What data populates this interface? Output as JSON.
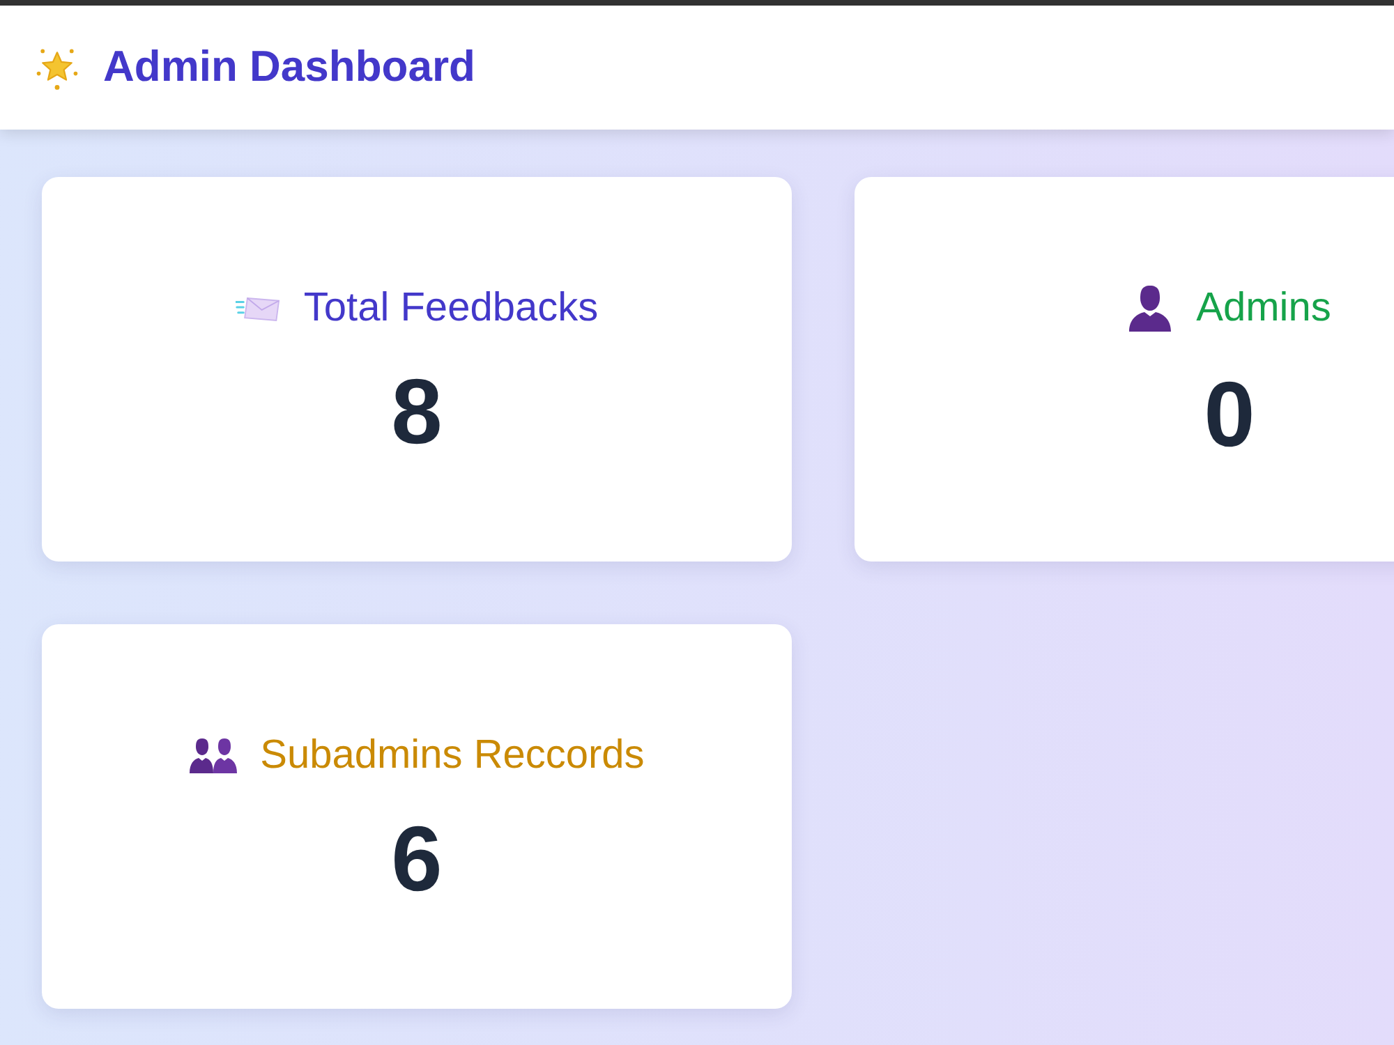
{
  "header": {
    "title": "Admin Dashboard"
  },
  "stats": [
    {
      "label": "Total Feedbacks",
      "value": "8",
      "color": "#4338ca"
    },
    {
      "label": "Admins",
      "value": "0",
      "color": "#16a34a"
    },
    {
      "label": "Subadmins Reccords",
      "value": "6",
      "color": "#ca8a04"
    }
  ]
}
